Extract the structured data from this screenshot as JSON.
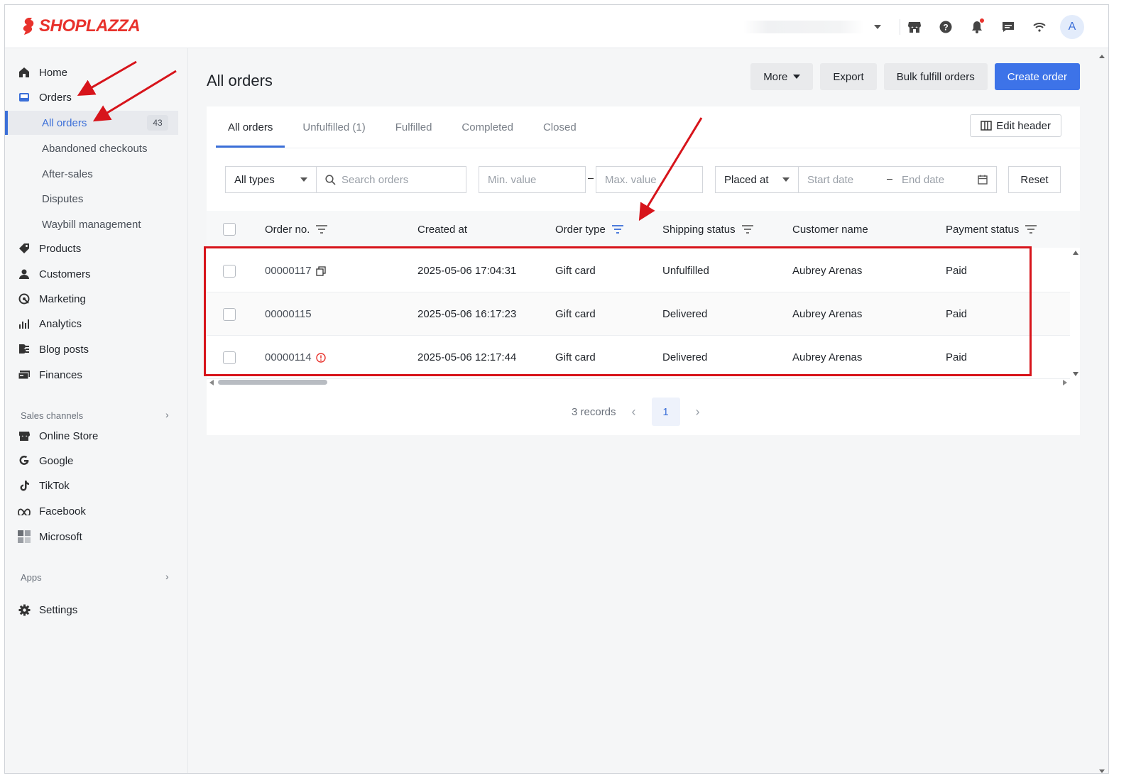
{
  "brand": {
    "name": "SHOPLAZZA",
    "color": "#e8322c"
  },
  "topbar": {
    "avatar_letter": "A",
    "icons": [
      "store-icon",
      "help-icon",
      "bell-icon",
      "message-icon",
      "wifi-icon"
    ]
  },
  "sidebar": {
    "items": [
      {
        "label": "Home",
        "icon": "home-icon"
      },
      {
        "label": "Orders",
        "icon": "orders-icon"
      }
    ],
    "orders_sub": {
      "active": {
        "label": "All orders",
        "badge": "43"
      },
      "items": [
        "Abandoned checkouts",
        "After-sales",
        "Disputes",
        "Waybill management"
      ]
    },
    "items2": [
      {
        "label": "Products",
        "icon": "tag-icon"
      },
      {
        "label": "Customers",
        "icon": "person-icon"
      },
      {
        "label": "Marketing",
        "icon": "marketing-icon"
      },
      {
        "label": "Analytics",
        "icon": "bar-chart-icon"
      },
      {
        "label": "Blog posts",
        "icon": "blog-icon"
      },
      {
        "label": "Finances",
        "icon": "finance-icon"
      }
    ],
    "sales_channels_label": "Sales channels",
    "channels": [
      {
        "label": "Online Store",
        "icon": "store-icon"
      },
      {
        "label": "Google",
        "icon": "google-icon"
      },
      {
        "label": "TikTok",
        "icon": "tiktok-icon"
      },
      {
        "label": "Facebook",
        "icon": "meta-icon"
      },
      {
        "label": "Microsoft",
        "icon": "microsoft-icon"
      }
    ],
    "apps_label": "Apps",
    "settings_label": "Settings"
  },
  "main": {
    "title": "All orders",
    "actions": {
      "more": "More",
      "export": "Export",
      "bulk": "Bulk fulfill orders",
      "create": "Create order"
    },
    "tabs": [
      "All orders",
      "Unfulfilled (1)",
      "Fulfilled",
      "Completed",
      "Closed"
    ],
    "edit_header": "Edit header",
    "filters": {
      "type": "All types",
      "search_placeholder": "Search orders",
      "min_placeholder": "Min. value",
      "max_placeholder": "Max. value",
      "date_field": "Placed at",
      "start_placeholder": "Start date",
      "end_placeholder": "End date",
      "reset": "Reset"
    },
    "columns": [
      "Order no.",
      "Created at",
      "Order type",
      "Shipping status",
      "Customer name",
      "Payment status"
    ],
    "rows": [
      {
        "order_no": "00000117",
        "created": "2025-05-06 17:04:31",
        "type": "Gift card",
        "shipping": "Unfulfilled",
        "customer": "Aubrey Arenas",
        "payment": "Paid",
        "flag": "copy-icon"
      },
      {
        "order_no": "00000115",
        "created": "2025-05-06 16:17:23",
        "type": "Gift card",
        "shipping": "Delivered",
        "customer": "Aubrey Arenas",
        "payment": "Paid",
        "flag": ""
      },
      {
        "order_no": "00000114",
        "created": "2025-05-06 12:17:44",
        "type": "Gift card",
        "shipping": "Delivered",
        "customer": "Aubrey Arenas",
        "payment": "Paid",
        "flag": "alert-icon"
      }
    ],
    "pagination": {
      "records": "3 records",
      "current_page": "1"
    }
  },
  "colors": {
    "accent": "#3b6fd8",
    "primary_button": "#3d73e8",
    "annotation_red": "#d7141b"
  }
}
